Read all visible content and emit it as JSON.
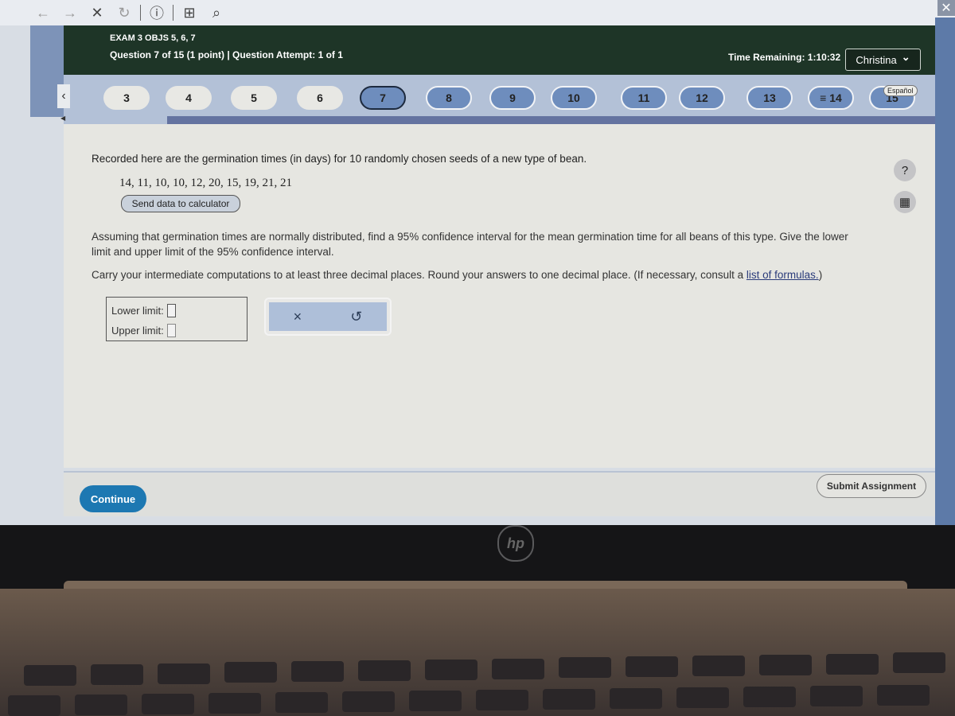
{
  "browser": {
    "back_icon": "←",
    "forward_icon": "→",
    "stop_icon": "✕",
    "reload_icon": "↻",
    "info_icon": "ⓘ",
    "new_page_icon": "⊞",
    "search_icon": "⌕",
    "close_icon": "✕"
  },
  "header": {
    "title": "EXAM 3 OBJS 5, 6, 7",
    "subtitle": "Question 7 of 15 (1 point)  |  Question Attempt: 1 of 1",
    "time_remaining": "Time Remaining: 1:10:32",
    "user_name": "Christina",
    "user_chevron": "⌄"
  },
  "nav": {
    "prev_icon": "‹",
    "questions": [
      {
        "label": "3",
        "state": "done"
      },
      {
        "label": "4",
        "state": "done"
      },
      {
        "label": "5",
        "state": "done"
      },
      {
        "label": "6",
        "state": "done"
      },
      {
        "label": "7",
        "state": "current"
      },
      {
        "label": "8",
        "state": "todo"
      },
      {
        "label": "9",
        "state": "todo"
      },
      {
        "label": "10",
        "state": "todo"
      },
      {
        "label": "11",
        "state": "todo"
      },
      {
        "label": "12",
        "state": "todo"
      },
      {
        "label": "13",
        "state": "todo"
      },
      {
        "label": "≡ 14",
        "state": "todo"
      },
      {
        "label": "15",
        "state": "todo"
      }
    ],
    "espanol_label": "Español"
  },
  "question": {
    "intro": "Recorded here are the germination times (in days) for 10 randomly chosen seeds of a new type of bean.",
    "data_values": "14, 11, 10, 10, 12, 20, 15, 19, 21, 21",
    "send_data_label": "Send data to calculator",
    "prompt": "Assuming that germination times are normally distributed, find a 95% confidence interval for the mean germination time for all beans of this type. Give the lower limit and upper limit of the 95% confidence interval.",
    "instructions_prefix": "Carry your intermediate computations to at least three decimal places. Round your answers to one decimal place. (If necessary, consult a ",
    "formulas_link": "list of formulas.",
    "instructions_suffix": ")"
  },
  "answer": {
    "lower_label": "Lower limit:",
    "lower_value": "",
    "upper_label": "Upper limit:",
    "upper_value": "",
    "clear_icon": "×",
    "undo_icon": "↺"
  },
  "side_tools": {
    "help_icon": "?",
    "calculator_icon": "▦"
  },
  "footer": {
    "continue_label": "Continue",
    "submit_label": "Submit Assignment"
  },
  "device": {
    "brand": "hp"
  }
}
